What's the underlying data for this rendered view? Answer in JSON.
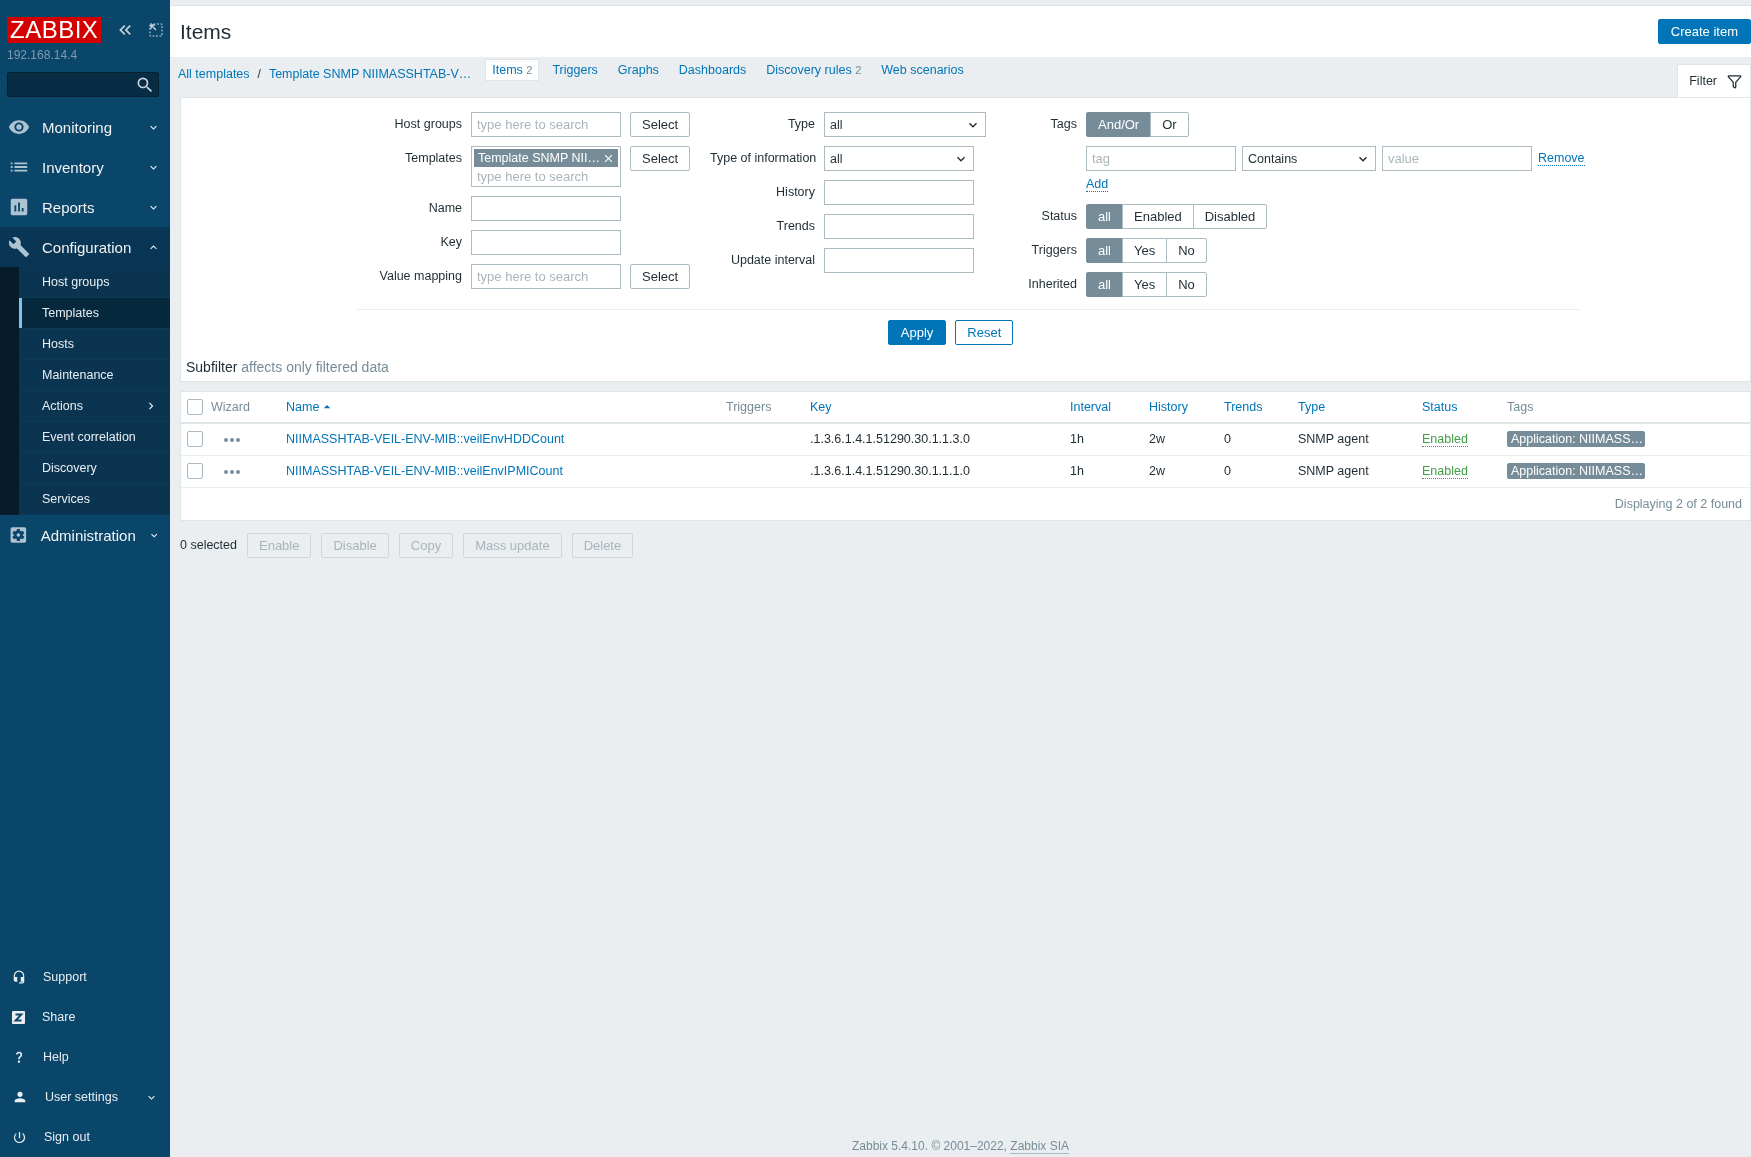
{
  "sidebar": {
    "logo": "ZABBIX",
    "server": "192.168.14.4",
    "menu": [
      {
        "label": "Monitoring",
        "expanded": false,
        "selected": false
      },
      {
        "label": "Inventory",
        "expanded": false,
        "selected": false
      },
      {
        "label": "Reports",
        "expanded": false,
        "selected": false
      },
      {
        "label": "Configuration",
        "expanded": true,
        "selected": true,
        "children": [
          {
            "label": "Host groups",
            "selected": false,
            "submenu": false
          },
          {
            "label": "Templates",
            "selected": true,
            "submenu": false
          },
          {
            "label": "Hosts",
            "selected": false,
            "submenu": false
          },
          {
            "label": "Maintenance",
            "selected": false,
            "submenu": false
          },
          {
            "label": "Actions",
            "selected": false,
            "submenu": true
          },
          {
            "label": "Event correlation",
            "selected": false,
            "submenu": false
          },
          {
            "label": "Discovery",
            "selected": false,
            "submenu": false
          },
          {
            "label": "Services",
            "selected": false,
            "submenu": false
          }
        ]
      },
      {
        "label": "Administration",
        "expanded": false,
        "selected": false
      }
    ],
    "bottom_menu": [
      {
        "label": "Support",
        "kind": "link"
      },
      {
        "label": "Share",
        "kind": "link"
      },
      {
        "label": "Help",
        "kind": "link"
      },
      {
        "label": "User settings",
        "kind": "submenu"
      },
      {
        "label": "Sign out",
        "kind": "link"
      }
    ]
  },
  "header": {
    "title": "Items",
    "create_button": "Create item"
  },
  "breadcrumbs": {
    "items": [
      "All templates",
      "Template SNMP NIIMASSHTAB-V…"
    ],
    "separator": "/"
  },
  "tabs": [
    {
      "label": "Items",
      "count": "2",
      "selected": true
    },
    {
      "label": "Triggers",
      "selected": false
    },
    {
      "label": "Graphs",
      "selected": false
    },
    {
      "label": "Dashboards",
      "selected": false
    },
    {
      "label": "Discovery rules",
      "count": "2",
      "selected": false
    },
    {
      "label": "Web scenarios",
      "selected": false
    }
  ],
  "filter": {
    "tab": "Filter",
    "left_fields": [
      {
        "label": "Host groups",
        "kind": "multiselect",
        "placeholder": "type here to search",
        "button": "Select"
      },
      {
        "label": "Templates",
        "kind": "multiselect",
        "chips": [
          "Template SNMP NII…"
        ],
        "placeholder": "type here to search",
        "button": "Select"
      },
      {
        "label": "Name",
        "kind": "text"
      },
      {
        "label": "Key",
        "kind": "text"
      },
      {
        "label": "Value mapping",
        "kind": "multiselect",
        "placeholder": "type here to search",
        "button": "Select"
      }
    ],
    "middle_fields": [
      {
        "label": "Type",
        "kind": "select",
        "value": "all"
      },
      {
        "label": "Type of information",
        "kind": "select",
        "value": "all"
      },
      {
        "label": "History",
        "kind": "text"
      },
      {
        "label": "Trends",
        "kind": "text"
      },
      {
        "label": "Update interval",
        "kind": "text"
      }
    ],
    "tags": {
      "label": "Tags",
      "options": [
        {
          "label": "And/Or",
          "selected": true
        },
        {
          "label": "Or",
          "selected": false
        }
      ],
      "tag_placeholder": "tag",
      "operator": "Contains",
      "value_placeholder": "value",
      "remove": "Remove",
      "add": "Add"
    },
    "radio_groups": [
      {
        "label": "Status",
        "options": [
          {
            "label": "all",
            "selected": true
          },
          {
            "label": "Enabled",
            "selected": false
          },
          {
            "label": "Disabled",
            "selected": false
          }
        ]
      },
      {
        "label": "Triggers",
        "options": [
          {
            "label": "all",
            "selected": true
          },
          {
            "label": "Yes",
            "selected": false
          },
          {
            "label": "No",
            "selected": false
          }
        ]
      },
      {
        "label": "Inherited",
        "options": [
          {
            "label": "all",
            "selected": true
          },
          {
            "label": "Yes",
            "selected": false
          },
          {
            "label": "No",
            "selected": false
          }
        ]
      }
    ],
    "apply": "Apply",
    "reset": "Reset"
  },
  "subfilter": {
    "title": "Subfilter",
    "note": "affects only filtered data"
  },
  "table": {
    "select_all_checked": false,
    "columns": [
      {
        "label": "Wizard",
        "link": false,
        "sorted": false
      },
      {
        "label": "Name",
        "link": true,
        "sorted": true
      },
      {
        "label": "Triggers",
        "link": false,
        "sorted": false
      },
      {
        "label": "Key",
        "link": true,
        "sorted": false
      },
      {
        "label": "Interval",
        "link": true,
        "sorted": false
      },
      {
        "label": "History",
        "link": true,
        "sorted": false
      },
      {
        "label": "Trends",
        "link": true,
        "sorted": false
      },
      {
        "label": "Type",
        "link": true,
        "sorted": false
      },
      {
        "label": "Status",
        "link": true,
        "sorted": false
      },
      {
        "label": "Tags",
        "link": false,
        "sorted": false
      }
    ],
    "rows": [
      {
        "checked": false,
        "name": "NIIMASSHTAB-VEIL-ENV-MIB::veilEnvHDDCount",
        "key": ".1.3.6.1.4.1.51290.30.1.1.3.0",
        "interval": "1h",
        "history": "2w",
        "trends": "0",
        "type": "SNMP agent",
        "status": {
          "text": "Enabled",
          "enabled": true
        },
        "tag": "Application: NIIMASS…"
      },
      {
        "checked": false,
        "name": "NIIMASSHTAB-VEIL-ENV-MIB::veilEnvIPMICount",
        "key": ".1.3.6.1.4.1.51290.30.1.1.1.0",
        "interval": "1h",
        "history": "2w",
        "trends": "0",
        "type": "SNMP agent",
        "status": {
          "text": "Enabled",
          "enabled": true
        },
        "tag": "Application: NIIMASS…"
      }
    ],
    "footer": "Displaying 2 of 2 found"
  },
  "mass_actions": {
    "selected": "0 selected",
    "buttons": [
      {
        "label": "Enable",
        "disabled": true
      },
      {
        "label": "Disable",
        "disabled": true
      },
      {
        "label": "Copy",
        "disabled": true
      },
      {
        "label": "Mass update",
        "disabled": true
      },
      {
        "label": "Delete",
        "disabled": true
      }
    ]
  },
  "footer": {
    "text": "Zabbix 5.4.10. © 2001–2022, ",
    "link": "Zabbix SIA"
  }
}
